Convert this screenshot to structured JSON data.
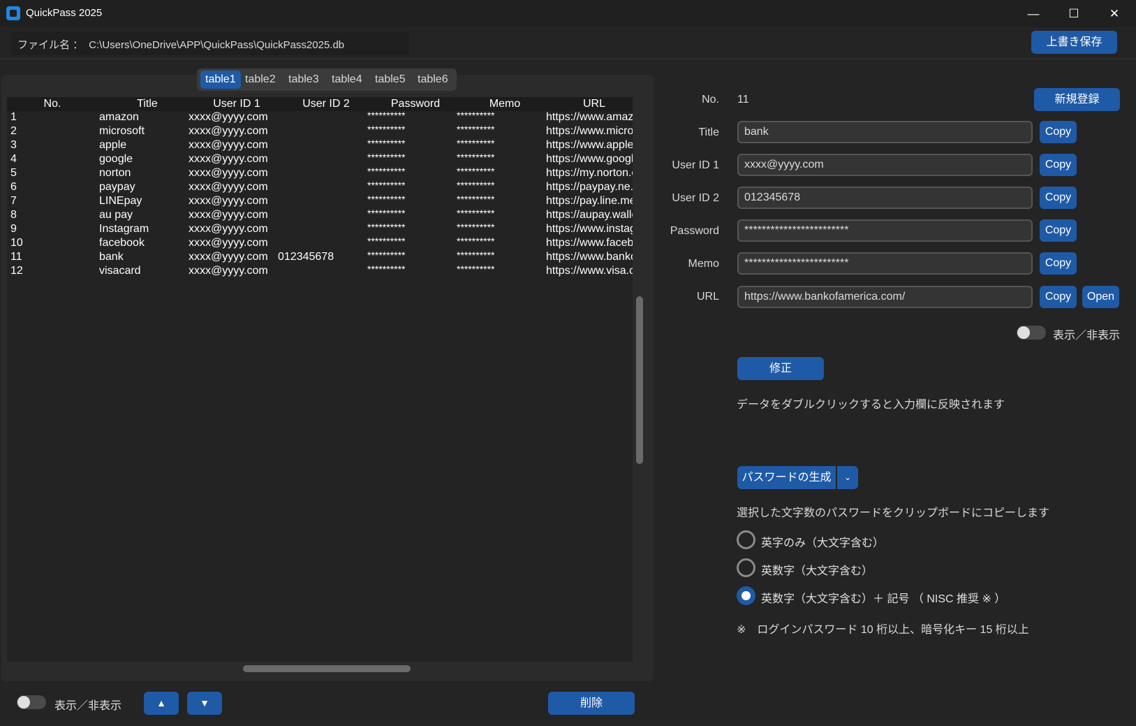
{
  "window": {
    "title": "QuickPass 2025",
    "minimize": "—",
    "maximize": "☐",
    "close": "✕"
  },
  "file": {
    "label": "ファイル名 ：",
    "path": "C:\\Users\\OneDrive\\APP\\QuickPass\\QuickPass2025.db",
    "save_label": "上書き保存"
  },
  "tabs": [
    "table1",
    "table2",
    "table3",
    "table4",
    "table5",
    "table6"
  ],
  "active_tab": "table1",
  "table": {
    "headers": [
      "No.",
      "Title",
      "User ID 1",
      "User ID 2",
      "Password",
      "Memo",
      "URL"
    ],
    "rows": [
      [
        "1",
        "amazon",
        "xxxx@yyyy.com",
        "",
        "**********",
        "**********",
        "https://www.amaz"
      ],
      [
        "2",
        "microsoft",
        "xxxx@yyyy.com",
        "",
        "**********",
        "**********",
        "https://www.micro"
      ],
      [
        "3",
        "apple",
        "xxxx@yyyy.com",
        "",
        "**********",
        "**********",
        "https://www.apple"
      ],
      [
        "4",
        "google",
        "xxxx@yyyy.com",
        "",
        "**********",
        "**********",
        "https://www.googl"
      ],
      [
        "5",
        "norton",
        "xxxx@yyyy.com",
        "",
        "**********",
        "**********",
        "https://my.norton.c"
      ],
      [
        "6",
        "paypay",
        "xxxx@yyyy.com",
        "",
        "**********",
        "**********",
        "https://paypay.ne."
      ],
      [
        "7",
        "LINEpay",
        "xxxx@yyyy.com",
        "",
        "**********",
        "**********",
        "https://pay.line.me"
      ],
      [
        "8",
        "au pay",
        "xxxx@yyyy.com",
        "",
        "**********",
        "**********",
        "https://aupay.walle"
      ],
      [
        "9",
        "Instagram",
        "xxxx@yyyy.com",
        "",
        "**********",
        "**********",
        "https://www.instag"
      ],
      [
        "10",
        "facebook",
        "xxxx@yyyy.com",
        "",
        "**********",
        "**********",
        "https://www.faceb"
      ],
      [
        "11",
        "bank",
        "xxxx@yyyy.com",
        "012345678",
        "**********",
        "**********",
        "https://www.bankc"
      ],
      [
        "12",
        "visacard",
        "xxxx@yyyy.com",
        "",
        "**********",
        "**********",
        "https://www.visa.c"
      ]
    ]
  },
  "left_bottom": {
    "toggle_label": "表示／非表示",
    "up_label": "▲",
    "down_label": "▼",
    "delete_label": "削除"
  },
  "form": {
    "no_label": "No.",
    "no_value": "11",
    "new_label": "新規登録",
    "title_label": "Title",
    "title_value": "bank",
    "userid1_label": "User ID 1",
    "userid1_value": "xxxx@yyyy.com",
    "userid2_label": "User ID 2",
    "userid2_value": "012345678",
    "password_label": "Password",
    "password_value": "************************",
    "memo_label": "Memo",
    "memo_value": "************************",
    "url_label": "URL",
    "url_value": "https://www.bankofamerica.com/",
    "copy_label": "Copy",
    "open_label": "Open",
    "toggle_label": "表示／非表示",
    "edit_label": "修正",
    "hint": "データをダブルクリックすると入力欄に反映されます"
  },
  "generator": {
    "button_label": "パスワードの生成",
    "arrow": "⌄",
    "description": "選択した文字数のパスワードをクリップボードにコピーします",
    "options": [
      "英字のみ（大文字含む）",
      "英数字（大文字含む）",
      "英数字（大文字含む）＋ 記号 （ NISC 推奨 ※ ）"
    ],
    "selected_index": 2,
    "note": "※　ログインパスワード 10 桁以上、暗号化キー 15 桁以上"
  }
}
